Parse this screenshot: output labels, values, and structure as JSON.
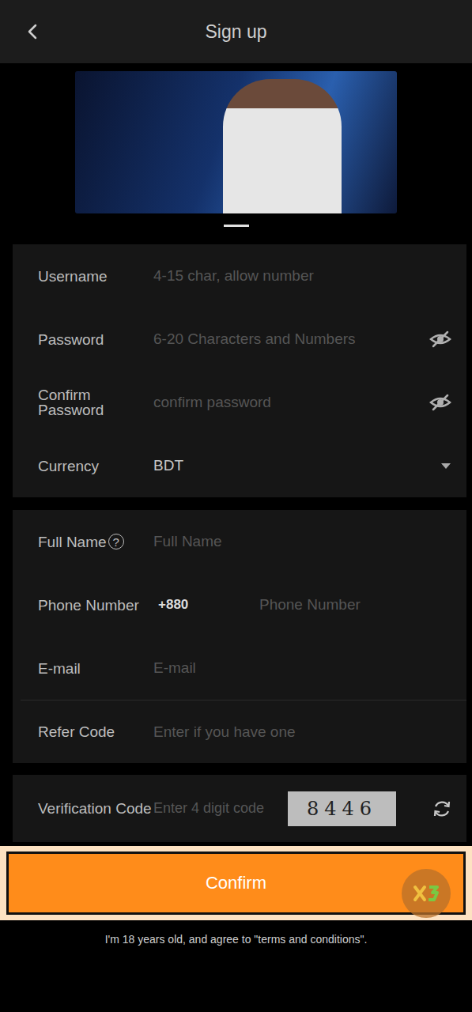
{
  "header": {
    "title": "Sign up"
  },
  "account_fields": [
    {
      "label": "Username",
      "placeholder": "4-15 char, allow number",
      "kind": "text"
    },
    {
      "label": "Password",
      "placeholder": "6-20 Characters and Numbers",
      "kind": "password"
    },
    {
      "label": "Confirm Password",
      "placeholder": "confirm password",
      "kind": "password"
    },
    {
      "label": "Currency",
      "value": "BDT",
      "kind": "select"
    }
  ],
  "profile_fields": [
    {
      "label": "Full Name",
      "help": "?",
      "placeholder": "Full Name",
      "kind": "text"
    },
    {
      "label": "Phone Number",
      "prefix": "+880",
      "placeholder": "Phone Number",
      "kind": "phone"
    },
    {
      "label": "E-mail",
      "placeholder": "E-mail",
      "kind": "text"
    },
    {
      "label": "Refer Code",
      "placeholder": "Enter if you have one",
      "kind": "text"
    }
  ],
  "verification": {
    "label": "Verification Code",
    "placeholder": "Enter 4 digit code",
    "captcha": "8446"
  },
  "confirm_button": {
    "label": "Confirm",
    "highlighted": true
  },
  "terms": "I'm 18 years old, and agree to \"terms and conditions\"."
}
